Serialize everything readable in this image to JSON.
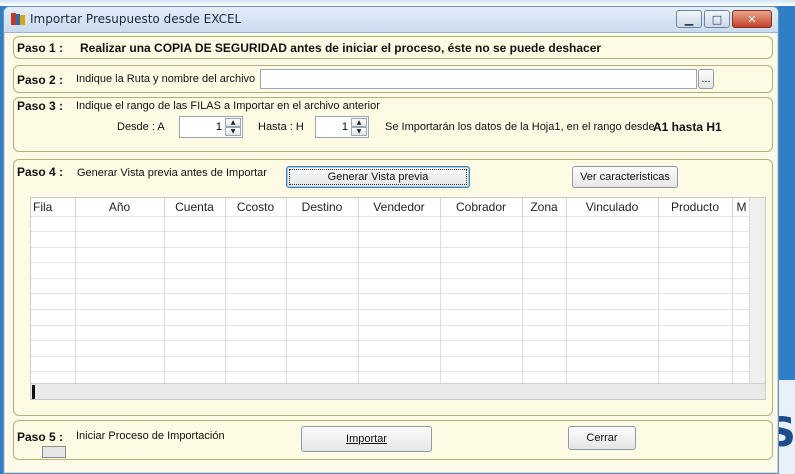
{
  "window": {
    "title": "Importar Presupuesto desde EXCEL"
  },
  "paso1": {
    "label": "Paso 1 :",
    "text": "Realizar una COPIA DE SEGURIDAD antes de iniciar el proceso, éste no se puede deshacer"
  },
  "paso2": {
    "label": "Paso 2 :",
    "text": "Indique la Ruta y nombre del archivo",
    "path_value": "",
    "browse_label": "..."
  },
  "paso3": {
    "label": "Paso 3 :",
    "text": "Indique el rango de las FILAS a Importar en el archivo anterior",
    "desde_label": "Desde  :  A",
    "desde_value": "1",
    "hasta_label": "Hasta  :  H",
    "hasta_value": "1",
    "info_prefix": "Se Importarán los datos de la Hoja1,  en el rango desde :",
    "info_range": "A1 hasta H1"
  },
  "paso4": {
    "label": "Paso 4 :",
    "text": "Generar Vista previa antes de Importar",
    "preview_button": "Generar Vista previa",
    "features_button": "Ver caracteristicas",
    "columns": [
      "Fila",
      "Año",
      "Cuenta",
      "Ccosto",
      "Destino",
      "Vendedor",
      "Cobrador",
      "Zona",
      "Vinculado",
      "Producto",
      "M"
    ]
  },
  "paso5": {
    "label": "Paso 5 :",
    "text": "Iniciar Proceso de Importación",
    "import_button": "Importar",
    "close_button": "Cerrar"
  }
}
